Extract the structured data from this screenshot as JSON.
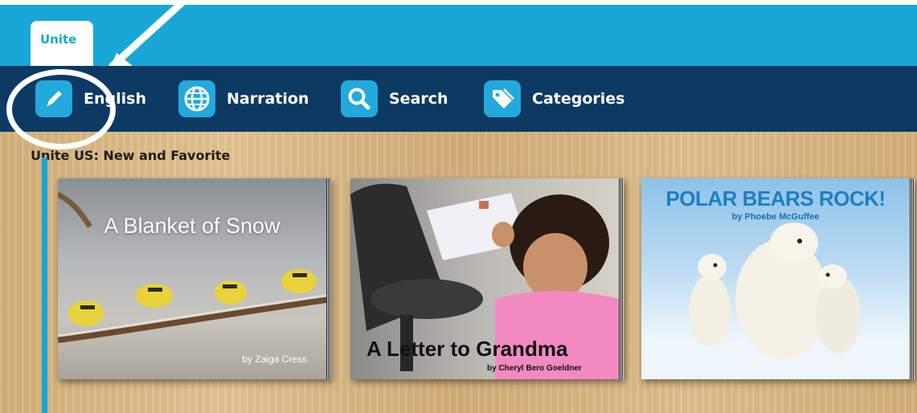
{
  "app": {
    "logo_text": "Unite"
  },
  "nav": {
    "items": [
      {
        "label": "English",
        "icon": "pencil-icon"
      },
      {
        "label": "Narration",
        "icon": "globe-icon"
      },
      {
        "label": "Search",
        "icon": "magnifier-icon"
      },
      {
        "label": "Categories",
        "icon": "tag-icon"
      }
    ]
  },
  "section": {
    "title": "Unite US:   New and Favorite"
  },
  "books": [
    {
      "title": "A Blanket of Snow",
      "author": "by Zaiga Cress"
    },
    {
      "title": "A Letter to Grandma",
      "author": "by Cheryl Bero Goeldner"
    },
    {
      "title": "POLAR BEARS ROCK!",
      "author": "by Phoebe McGuffee"
    }
  ],
  "colors": {
    "topbar": "#18a7d6",
    "navbar": "#0d3a63",
    "icon_bg": "#23a9dc",
    "annotation": "#ffffff"
  }
}
